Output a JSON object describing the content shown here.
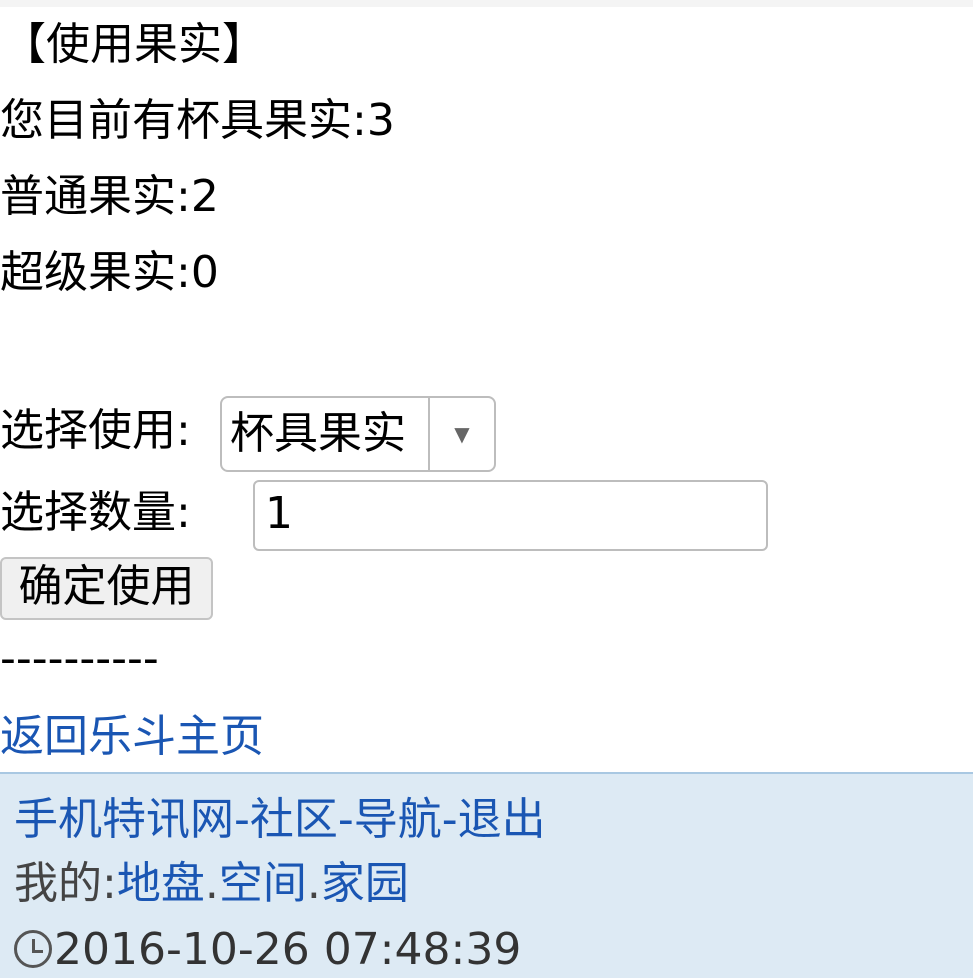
{
  "page": {
    "title": "【使用果实】",
    "current_total": "您目前有杯具果实:3",
    "normal_count": "普通果实:2",
    "super_count": "超级果实:0"
  },
  "form": {
    "select_label": "选择使用:",
    "select_value": "杯具果实",
    "quantity_label": "选择数量:",
    "quantity_value": "1",
    "submit_label": "确定使用"
  },
  "divider": "----------",
  "links": {
    "home": "返回乐斗主页"
  },
  "footer": {
    "nav": {
      "site": "手机特讯网",
      "community": "社区",
      "navigation": "导航",
      "logout": "退出",
      "separator": "-"
    },
    "mine": {
      "label": "我的:",
      "territory": "地盘",
      "space": "空间",
      "home": "家园",
      "separator": "."
    },
    "timestamp": "2016-10-26 07:48:39"
  },
  "icons": {
    "dropdown": "chevron-down-icon",
    "clock": "clock-icon"
  },
  "colors": {
    "link": "#1a56b3",
    "footer_bg": "#ddeaf4"
  }
}
